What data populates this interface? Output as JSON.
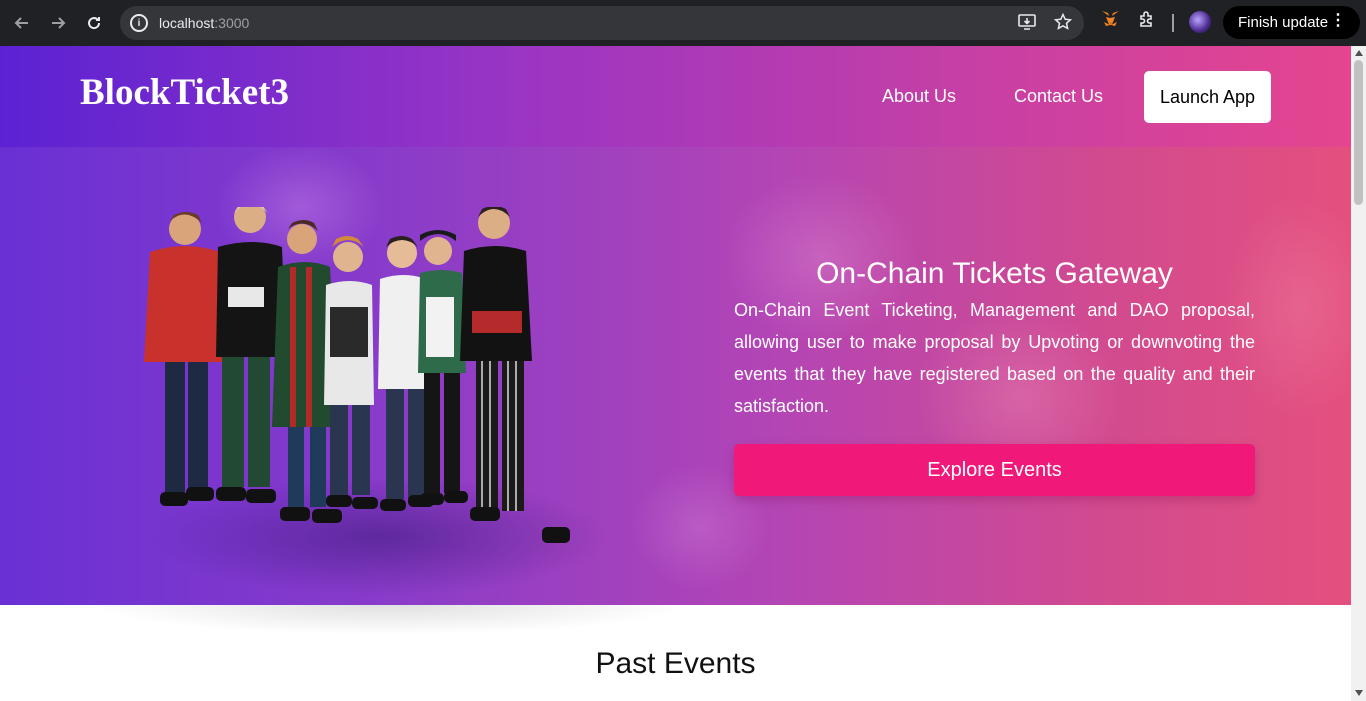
{
  "browser": {
    "url_host": "localhost",
    "url_port": ":3000",
    "update_label": "Finish update",
    "icons": [
      "back-arrow-icon",
      "forward-arrow-icon",
      "reload-icon",
      "site-info-icon",
      "install-app-icon",
      "star-icon",
      "metamask-fox-icon",
      "extensions-puzzle-icon",
      "profile-avatar-icon",
      "menu-dots-icon"
    ]
  },
  "header": {
    "brand": "BlockTicket3",
    "nav": [
      "About Us",
      "Contact Us"
    ],
    "launch_label": "Launch App",
    "gradient": [
      "#5b22d3",
      "#e5458e"
    ]
  },
  "hero": {
    "title": "On-Chain Tickets Gateway",
    "description": "On-Chain Event Ticketing, Management and DAO proposal, allowing user to make proposal by Upvoting or downvoting the events that they have registered based on the quality and their satisfaction.",
    "cta_label": "Explore Events",
    "cta_color": "#f0197a"
  },
  "sections": {
    "past_events_title": "Past Events"
  }
}
